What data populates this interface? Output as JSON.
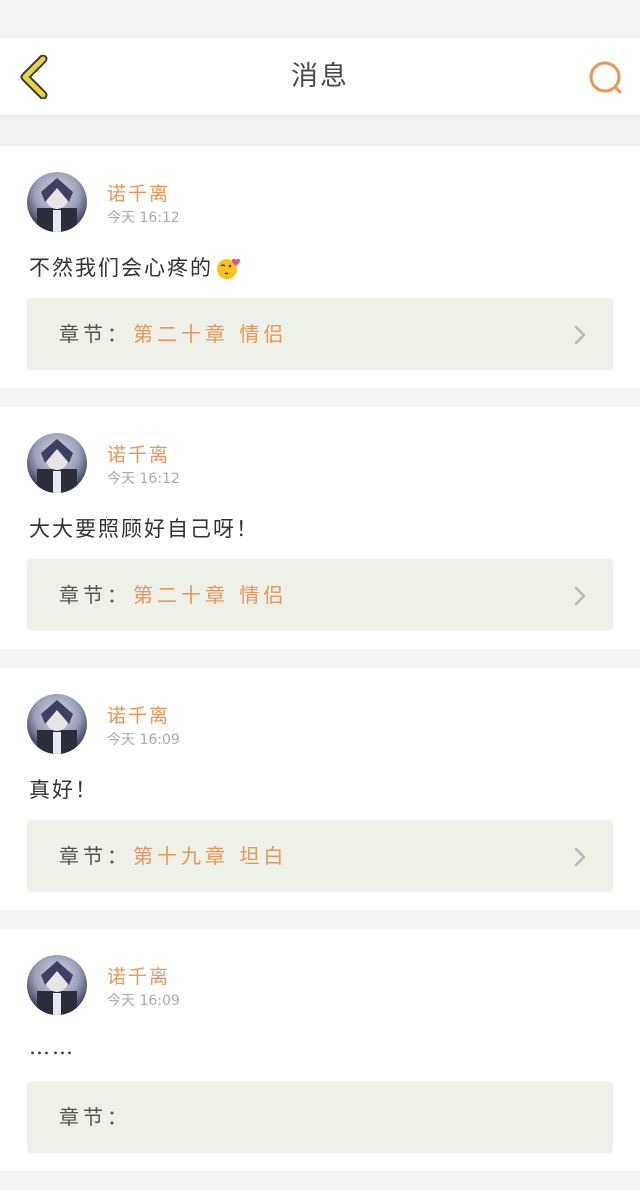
{
  "header": {
    "title": "消息",
    "back_icon": "chevron-left-icon",
    "search_icon": "search-icon",
    "accent": "#e8965a",
    "back_color": "#e9d53b"
  },
  "messages": [
    {
      "username": "诺千离",
      "time": "今天 16:12",
      "text": "不然我们会心疼的",
      "emoji": "kiss-emoji",
      "chapter_label": "章节：",
      "chapter_title": "第二十章 情侣"
    },
    {
      "username": "诺千离",
      "time": "今天 16:12",
      "text": "大大要照顾好自己呀！",
      "chapter_label": "章节：",
      "chapter_title": "第二十章 情侣"
    },
    {
      "username": "诺千离",
      "time": "今天 16:09",
      "text": "真好！",
      "chapter_label": "章节：",
      "chapter_title": "第十九章 坦白"
    },
    {
      "username": "诺千离",
      "time": "今天 16:09",
      "text": "……",
      "chapter_label": "章节：",
      "chapter_title": ""
    }
  ]
}
